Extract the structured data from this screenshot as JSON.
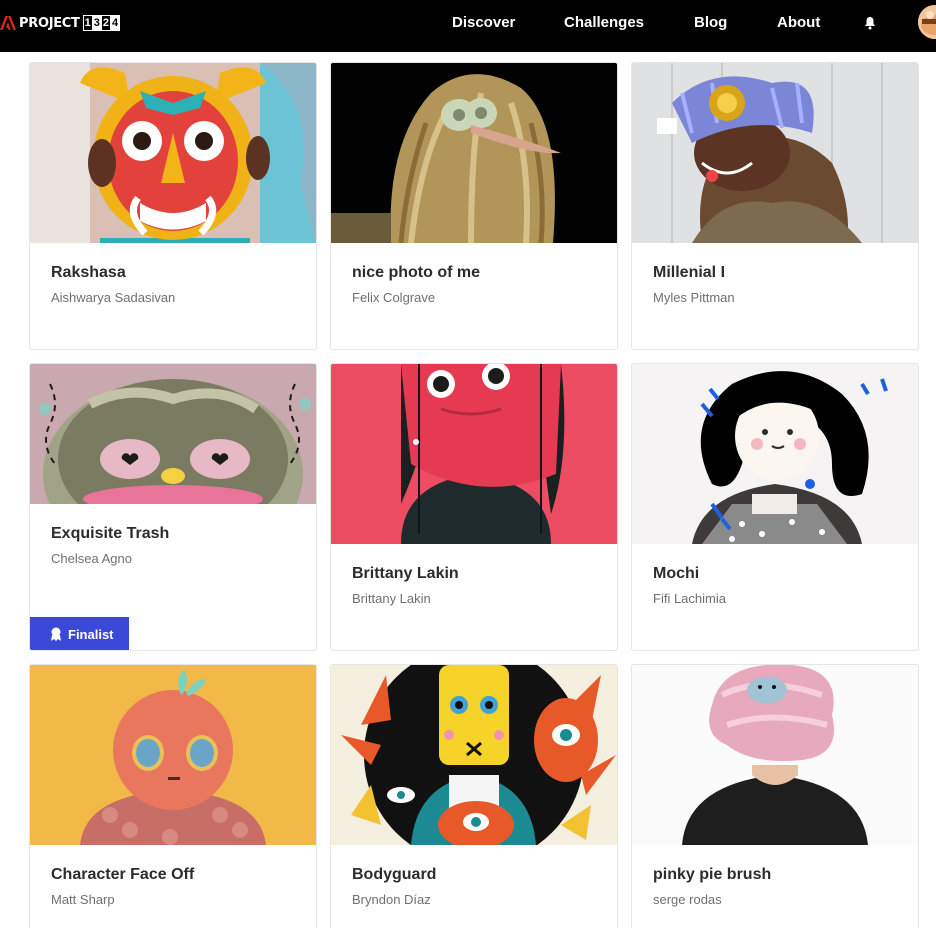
{
  "header": {
    "logo_text": "PROJECT",
    "logo_digits": [
      "1",
      "3",
      "2",
      "4"
    ],
    "nav": [
      "Discover",
      "Challenges",
      "Blog",
      "About"
    ],
    "bell_icon": "bell-icon",
    "avatar_icon": "user-avatar"
  },
  "cards": [
    {
      "title": "Rakshasa",
      "author": "Aishwarya Sadasivan"
    },
    {
      "title": "nice photo of me",
      "author": "Felix Colgrave"
    },
    {
      "title": "Millenial I",
      "author": "Myles Pittman"
    },
    {
      "title": "Exquisite Trash",
      "author": "Chelsea Agno",
      "badge": "Finalist"
    },
    {
      "title": "Brittany Lakin",
      "author": "Brittany Lakin"
    },
    {
      "title": "Mochi",
      "author": "Fifi Lachimia"
    },
    {
      "title": "Character Face Off",
      "author": "Matt Sharp"
    },
    {
      "title": "Bodyguard",
      "author": "Bryndon Díaz"
    },
    {
      "title": "pinky pie brush",
      "author": "serge rodas"
    }
  ],
  "colors": {
    "header_bg": "#000000",
    "badge_bg": "#3b48d8",
    "logo_red": "#e1251b"
  }
}
